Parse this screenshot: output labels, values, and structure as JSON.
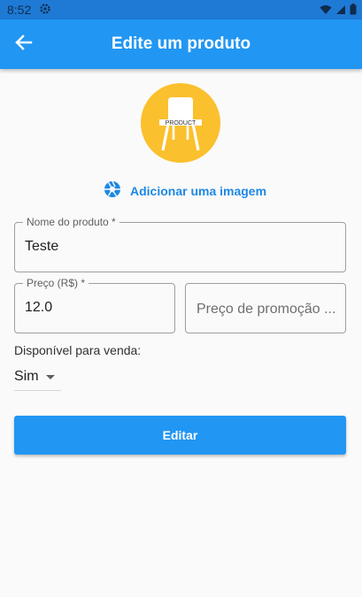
{
  "status_bar": {
    "time": "8:52"
  },
  "app_bar": {
    "title": "Edite um produto"
  },
  "product_image": {
    "badge_text": "PRODUCT"
  },
  "add_image": {
    "label": "Adicionar uma imagem"
  },
  "form": {
    "name": {
      "label": "Nome do produto *",
      "value": "Teste"
    },
    "price": {
      "label": "Preço (R$) *",
      "value": "12.0"
    },
    "promo_price": {
      "placeholder": "Preço de promoção ..."
    },
    "available": {
      "label": "Disponível para venda:",
      "value": "Sim"
    }
  },
  "submit": {
    "label": "Editar"
  },
  "colors": {
    "primary": "#2196f3",
    "status_bar": "#1f7ad6",
    "avatar_bg": "#fbc02d",
    "link": "#1e88e5"
  }
}
